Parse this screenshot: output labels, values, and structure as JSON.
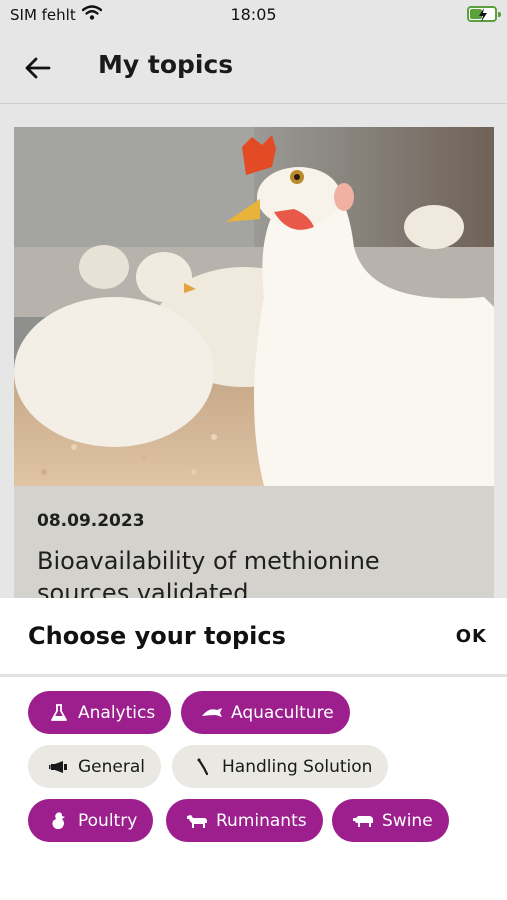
{
  "status_bar": {
    "carrier": "SIM fehlt",
    "time": "18:05",
    "battery_color": "#5aa03c"
  },
  "header": {
    "title": "My topics",
    "back_icon": "arrow-left-icon"
  },
  "article": {
    "date": "08.09.2023",
    "title": "Bioavailability of methionine sources validated"
  },
  "topics_sheet": {
    "title": "Choose your topics",
    "ok_label": "OK",
    "accent_color": "#9c1f8d",
    "topics": [
      {
        "label": "Analytics",
        "icon": "flask-icon",
        "selected": true
      },
      {
        "label": "Aquaculture",
        "icon": "fish-icon",
        "selected": true
      },
      {
        "label": "General",
        "icon": "megaphone-icon",
        "selected": false
      },
      {
        "label": "Handling Solution",
        "icon": "hook-icon",
        "selected": false
      },
      {
        "label": "Poultry",
        "icon": "chicken-icon",
        "selected": true
      },
      {
        "label": "Ruminants",
        "icon": "cow-icon",
        "selected": true
      },
      {
        "label": "Swine",
        "icon": "pig-icon",
        "selected": true
      }
    ]
  }
}
